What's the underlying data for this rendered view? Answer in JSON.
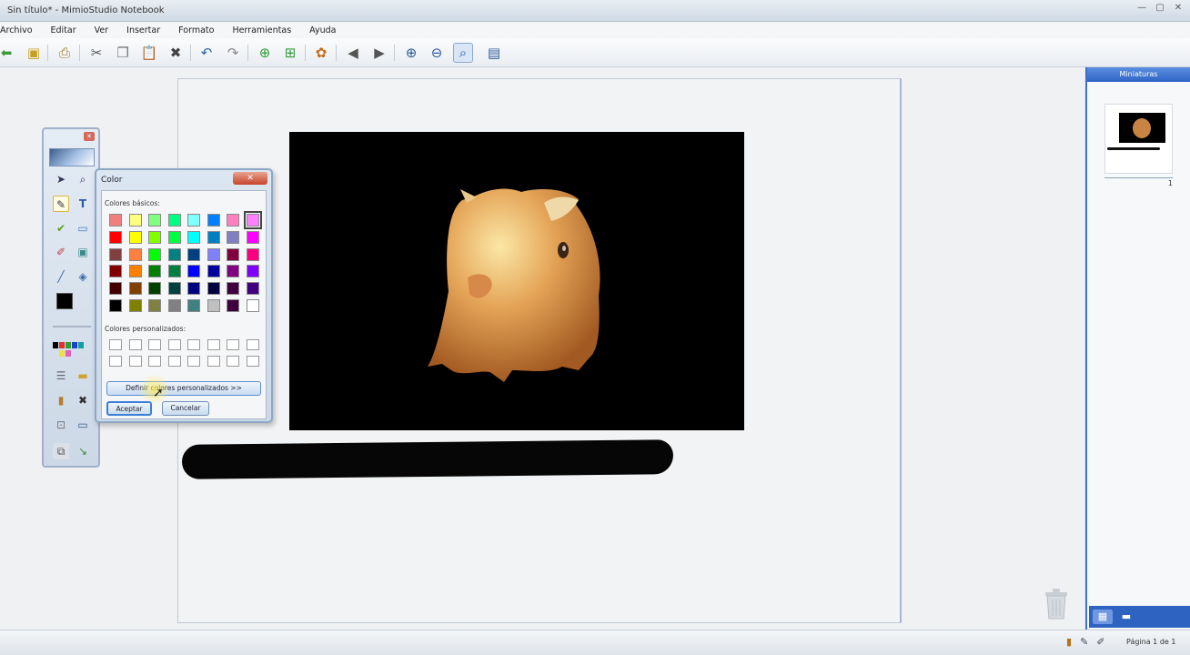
{
  "window": {
    "title": "Sin título* - MimioStudio Notebook",
    "buttons": [
      "—",
      "▢",
      "✕"
    ]
  },
  "menu": [
    "Archivo",
    "Editar",
    "Ver",
    "Insertar",
    "Formato",
    "Herramientas",
    "Ayuda"
  ],
  "toolbar": {
    "icons": [
      "back-arrow-icon",
      "save-icon",
      "print-icon",
      "cut-icon",
      "copy-icon",
      "paste-icon",
      "delete-icon",
      "undo-icon",
      "redo-icon",
      "new-page-icon",
      "new-page-plus-icon",
      "gallery-icon",
      "previous-page-icon",
      "next-page-icon",
      "zoom-in-icon",
      "zoom-out-icon",
      "zoom-fit-icon",
      "screen-icon"
    ]
  },
  "color_dialog": {
    "title": "Color",
    "close": "✕",
    "basic_label": "Colores básicos:",
    "custom_label": "Colores personalizados:",
    "define_button": "Definir colores personalizados >>",
    "ok_button": "Aceptar",
    "cancel_button": "Cancelar",
    "basic_colors": [
      "#f08080",
      "#ffff80",
      "#80ff80",
      "#00ff80",
      "#80ffff",
      "#0080ff",
      "#ff80c0",
      "#ff80ff",
      "#ff0000",
      "#ffff00",
      "#80ff00",
      "#00ff40",
      "#00ffff",
      "#0080c0",
      "#8080c0",
      "#ff00ff",
      "#804040",
      "#ff8040",
      "#00ff00",
      "#008080",
      "#004080",
      "#8080ff",
      "#800040",
      "#ff0080",
      "#800000",
      "#ff8000",
      "#008000",
      "#008040",
      "#0000ff",
      "#0000a0",
      "#800080",
      "#8000ff",
      "#400000",
      "#804000",
      "#004000",
      "#004040",
      "#000080",
      "#000040",
      "#400040",
      "#400080",
      "#000000",
      "#808000",
      "#808040",
      "#808080",
      "#408080",
      "#c0c0c0",
      "#400040",
      "#ffffff"
    ],
    "selected_index": 7
  },
  "thumbnails": {
    "header": "Miniaturas",
    "page_number": "1"
  },
  "status": {
    "page": "Página 1 de 1"
  },
  "colors": {
    "accent": "#3d6fd1",
    "stroke": "#060606",
    "photo_bg": "#000000"
  }
}
